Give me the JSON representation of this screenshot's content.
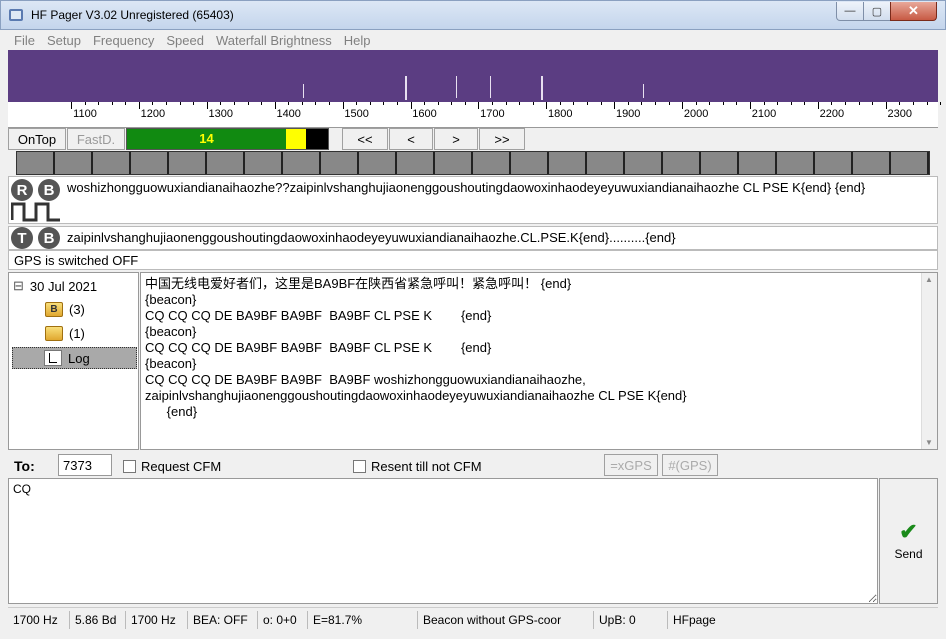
{
  "window": {
    "title": "HF Pager V3.02 Unregistered (65403)",
    "min_glyph": "—",
    "max_glyph": "▢",
    "close_glyph": "✕"
  },
  "menu": [
    "File",
    "Setup",
    "Frequency",
    "Speed",
    "Waterfall Brightness",
    "Help"
  ],
  "scale": {
    "labels": [
      "1100",
      "1200",
      "1300",
      "1400",
      "1500",
      "1600",
      "1700",
      "1800",
      "1900",
      "2000",
      "2100",
      "2200",
      "2300"
    ]
  },
  "controls": {
    "ontop_label": "OnTop",
    "fastd_label": "FastD.",
    "level_value": "14",
    "level_fraction": 0.79,
    "nav_first": "<<",
    "nav_prev": "<",
    "nav_next": ">",
    "nav_last": ">>"
  },
  "rx": {
    "badge_r": "R",
    "badge_b": "B",
    "text": "woshizhongguowuxiandianaihaozhe??zaipinlvshanghujiaonenggoushoutingdaowoxinhaodeyeyuwuxiandianaihaozhe CL PSE K{end}         {end}"
  },
  "tx": {
    "badge_t": "T",
    "badge_b": "B",
    "text": "zaipinlvshanghujiaonenggoushoutingdaowoxinhaodeyeyuwuxiandianaihaozhe.CL.PSE.K{end}..........{end}"
  },
  "gps_status": "GPS is switched OFF",
  "tree": {
    "expander": "⊟",
    "date": "30 Jul 2021",
    "beacon_badge": "B",
    "beacon_count": "(3)",
    "inbox_count": "(1)",
    "log_label": "Log"
  },
  "log": {
    "text": "中国无线电爱好者们，这里是BA9BF在陕西省紧急呼叫！紧急呼叫！ {end}\n{beacon}\nCQ CQ CQ DE BA9BF BA9BF  BA9BF CL PSE K        {end}\n{beacon}\nCQ CQ CQ DE BA9BF BA9BF  BA9BF CL PSE K        {end}\n{beacon}\nCQ CQ CQ DE BA9BF BA9BF  BA9BF woshizhongguowuxiandianaihaozhe,\nzaipinlvshanghujiaonenggoushoutingdaowoxinhaodeyeyuwuxiandianaihaozhe CL PSE K{end}\n      {end}"
  },
  "to": {
    "label": "To:",
    "value": "7373"
  },
  "options": {
    "request_cfm": "Request CFM",
    "resent_label": "Resent till not CFM",
    "xgps_label": "=xGPS",
    "fgps_label": "#(GPS)"
  },
  "compose": {
    "value": "CQ"
  },
  "send": {
    "icon": "✔",
    "label": "Send"
  },
  "status": [
    "1700 Hz",
    "5.86 Bd",
    "1700 Hz",
    "BEA: OFF",
    "o: 0+0",
    "E=81.7%",
    "Beacon without GPS-coor",
    "UpB: 0",
    "HFpage"
  ]
}
